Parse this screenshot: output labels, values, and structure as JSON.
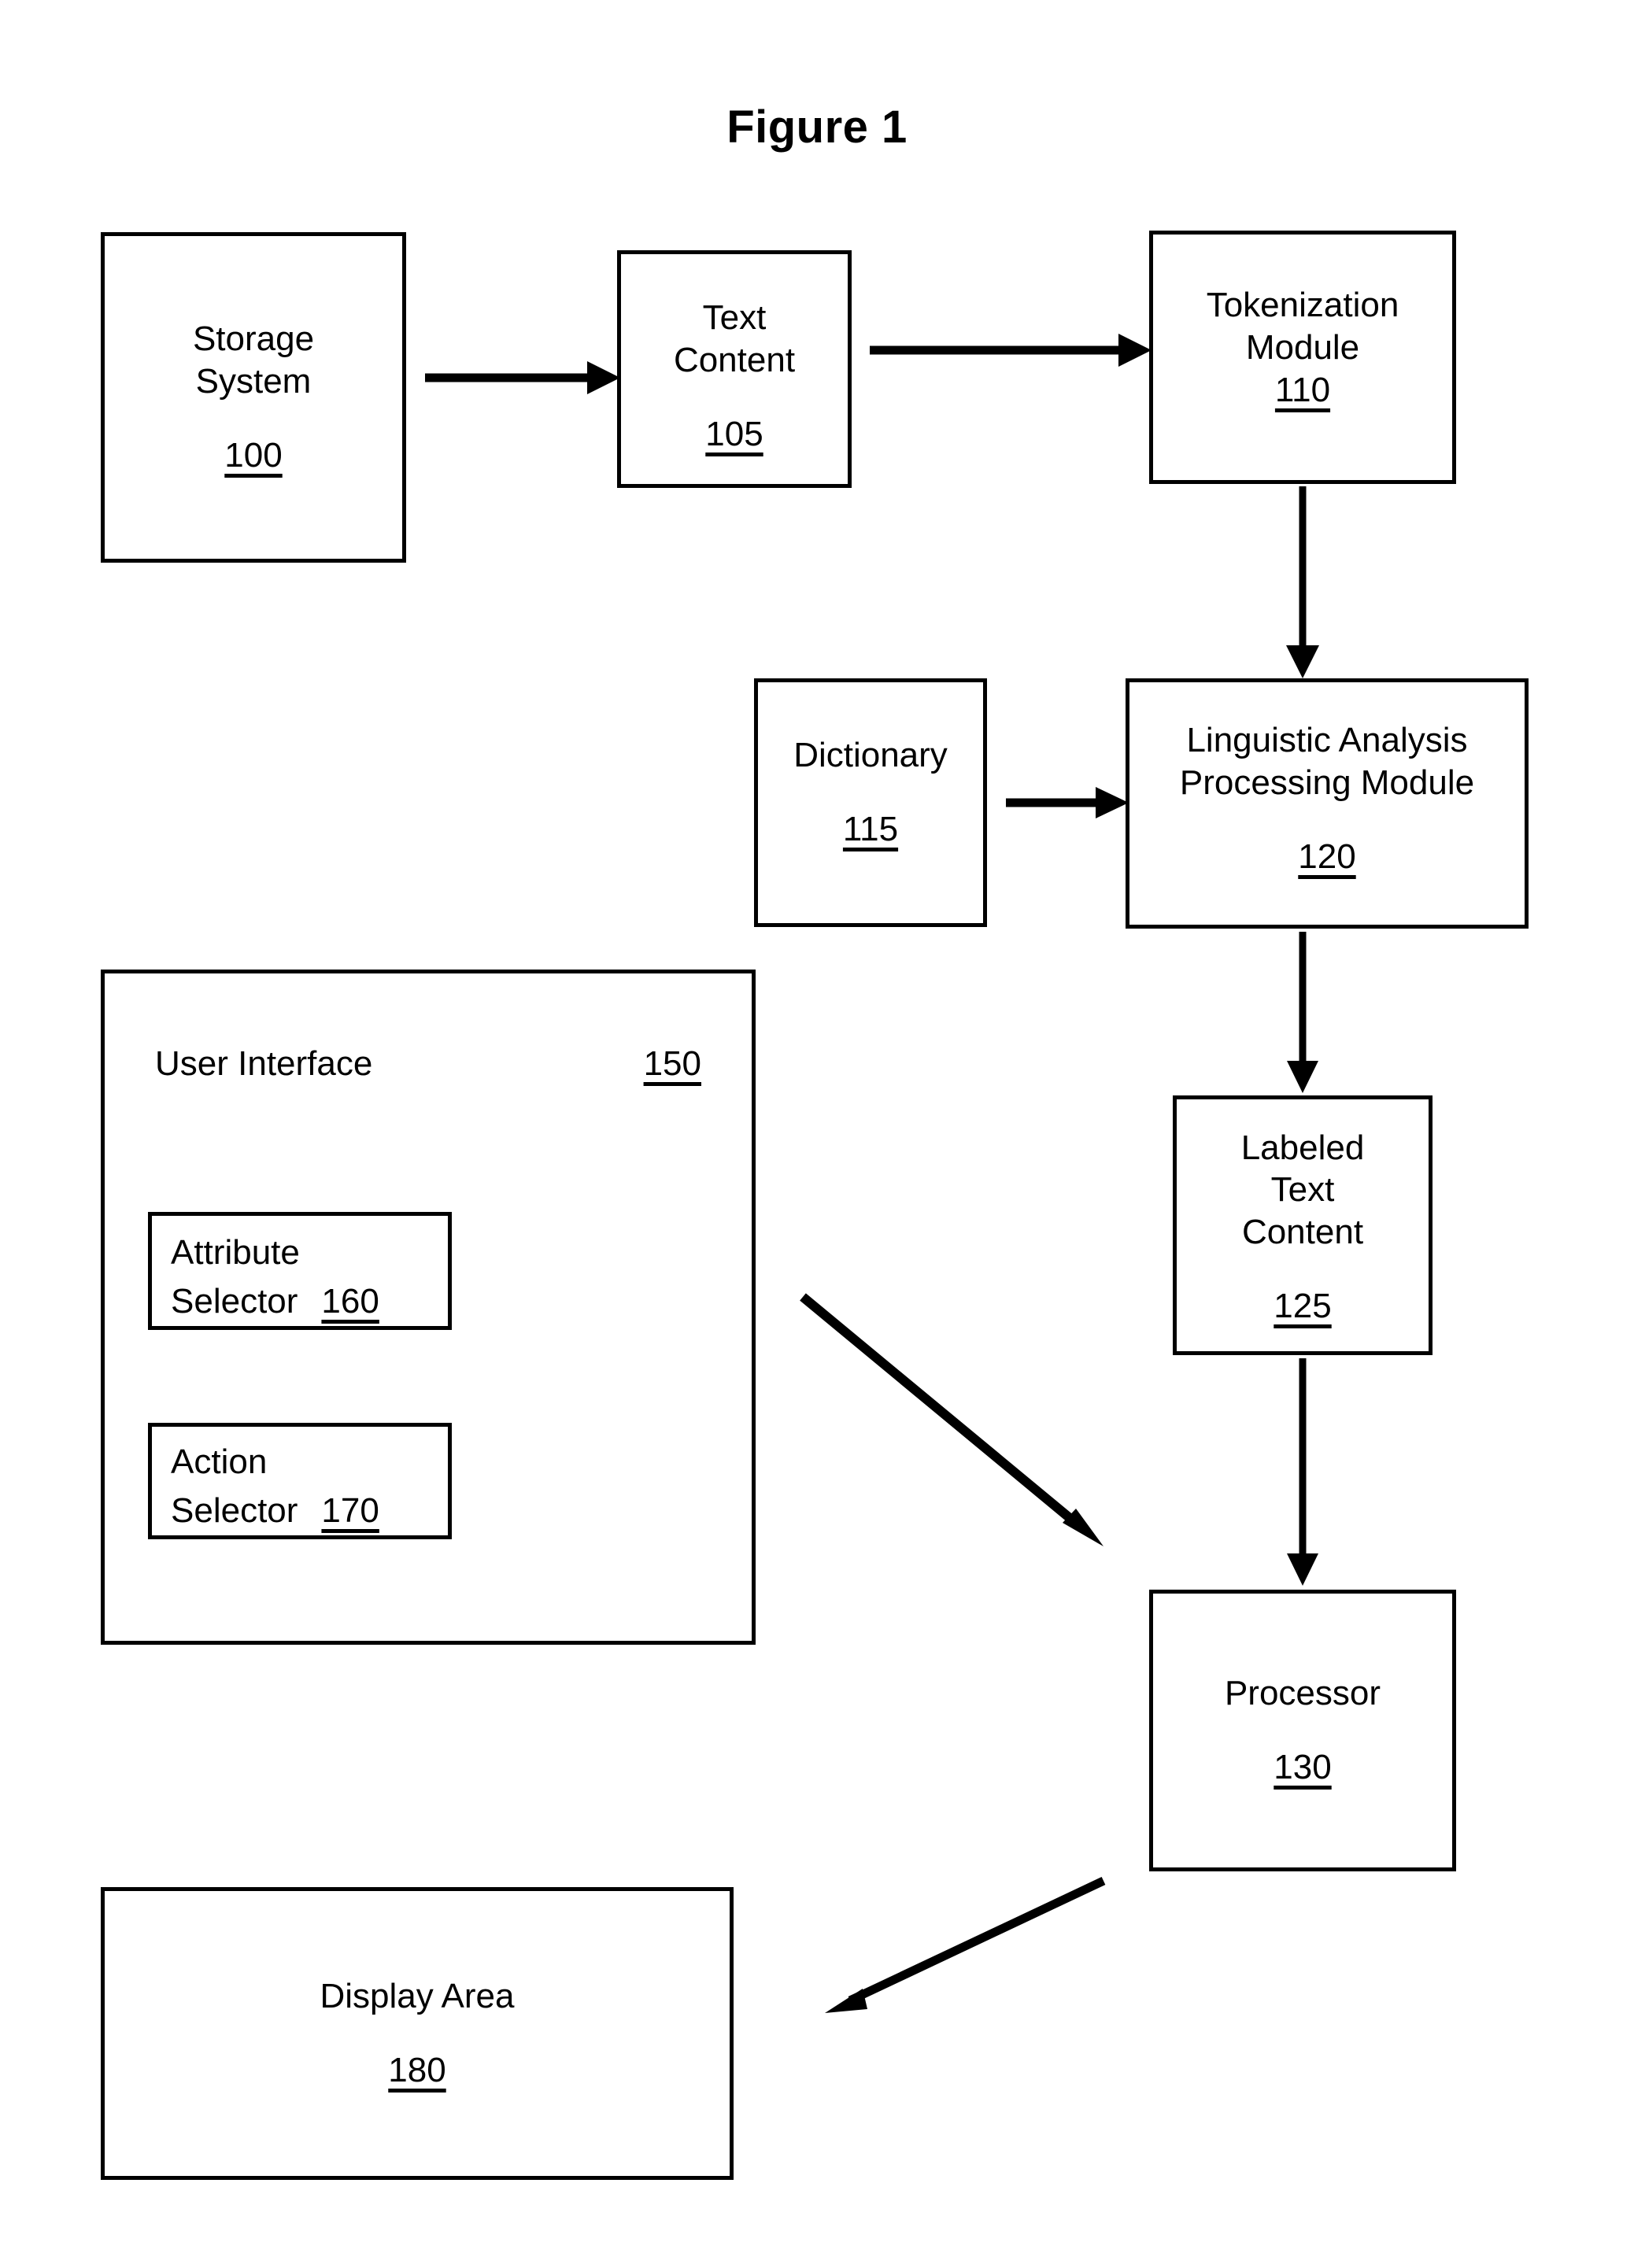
{
  "figure": {
    "title": "Figure 1"
  },
  "blocks": {
    "storage_system": {
      "lines": [
        "Storage",
        "System"
      ],
      "ref": "100"
    },
    "text_content": {
      "lines": [
        "Text",
        "Content"
      ],
      "ref": "105"
    },
    "tokenization_module": {
      "lines": [
        "Tokenization",
        "Module"
      ],
      "ref": "110"
    },
    "dictionary": {
      "lines": [
        "Dictionary"
      ],
      "ref": "115"
    },
    "linguistic_analysis_processing_module": {
      "lines": [
        "Linguistic Analysis",
        "Processing Module"
      ],
      "ref": "120"
    },
    "labeled_text_content": {
      "lines": [
        "Labeled",
        "Text",
        "Content"
      ],
      "ref": "125"
    },
    "processor": {
      "lines": [
        "Processor"
      ],
      "ref": "130"
    },
    "user_interface": {
      "label": "User Interface",
      "ref": "150"
    },
    "attribute_selector": {
      "line1": "Attribute",
      "line2": "Selector",
      "ref": "160"
    },
    "action_selector": {
      "line1": "Action",
      "line2": "Selector",
      "ref": "170"
    },
    "display_area": {
      "lines": [
        "Display Area"
      ],
      "ref": "180"
    }
  },
  "connections": [
    {
      "id": "storage-to-text",
      "from": "storage_system",
      "to": "text_content",
      "style": "horizontal-arrow"
    },
    {
      "id": "text-to-tokenize",
      "from": "text_content",
      "to": "tokenization_module",
      "style": "horizontal-arrow"
    },
    {
      "id": "tokenize-to-linguistic",
      "from": "tokenization_module",
      "to": "linguistic_analysis_processing_module",
      "style": "vertical-arrow"
    },
    {
      "id": "dictionary-to-linguistic",
      "from": "dictionary",
      "to": "linguistic_analysis_processing_module",
      "style": "horizontal-arrow"
    },
    {
      "id": "linguistic-to-labeled",
      "from": "linguistic_analysis_processing_module",
      "to": "labeled_text_content",
      "style": "vertical-arrow"
    },
    {
      "id": "labeled-to-processor",
      "from": "labeled_text_content",
      "to": "processor",
      "style": "vertical-arrow"
    },
    {
      "id": "ui-to-processor",
      "from": "user_interface",
      "to": "processor",
      "style": "diagonal-arrow-down-right"
    },
    {
      "id": "processor-to-display",
      "from": "processor",
      "to": "display_area",
      "style": "diagonal-arrow-down-left"
    }
  ],
  "colors": {
    "stroke": "#000000",
    "background": "#ffffff"
  }
}
